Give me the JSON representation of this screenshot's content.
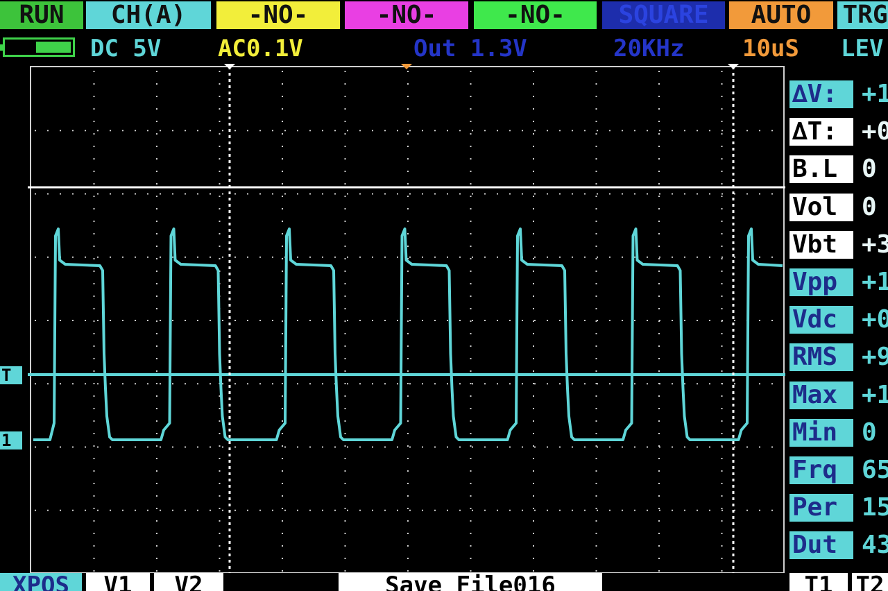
{
  "top_tabs": [
    {
      "label": "RUN",
      "bg": "#3dc33b"
    },
    {
      "label": "CH(A)",
      "bg": "#5fd6d8"
    },
    {
      "label": "-NO-",
      "bg": "#f2ee3a"
    },
    {
      "label": "-NO-",
      "bg": "#e93fe3"
    },
    {
      "label": "-NO-",
      "bg": "#3fe84c"
    },
    {
      "label": "SQUARE",
      "bg": "#1d2dac"
    },
    {
      "label": "AUTO",
      "bg": "#f29a3a"
    },
    {
      "label": "TRG",
      "bg": "#5fd6d8"
    }
  ],
  "status": {
    "coupling": "DC 5V",
    "ac": "AC0.1V",
    "out": "Out 1.3V",
    "freq": "20KHz",
    "timebase": "10uS",
    "trigger": "LEV"
  },
  "markers": {
    "trigger": "T",
    "channel": "1"
  },
  "measurements": [
    {
      "label": "∆V:",
      "value": "+1",
      "style": "cy"
    },
    {
      "label": "∆T:",
      "value": "+0",
      "style": "wh"
    },
    {
      "label": "B.L",
      "value": "0",
      "style": "wh"
    },
    {
      "label": "Vol",
      "value": "0",
      "style": "wh"
    },
    {
      "label": "Vbt",
      "value": "+3",
      "style": "wh"
    },
    {
      "label": "Vpp",
      "value": "+1",
      "style": "cy"
    },
    {
      "label": "Vdc",
      "value": "+0",
      "style": "cy"
    },
    {
      "label": "RMS",
      "value": "+9",
      "style": "cy"
    },
    {
      "label": "Max",
      "value": "+1",
      "style": "cy"
    },
    {
      "label": "Min",
      "value": "0",
      "style": "cy"
    },
    {
      "label": "Frq",
      "value": "65",
      "style": "cy"
    },
    {
      "label": "Per",
      "value": "15",
      "style": "cy"
    },
    {
      "label": "Dut",
      "value": "43",
      "style": "cy"
    }
  ],
  "bottom": {
    "xpos": "XPOS",
    "v1": "V1",
    "v2": "V2",
    "save": "Save File016",
    "t1": "T1",
    "t2": "T2"
  },
  "colors": {
    "trace": "#5fd6d8",
    "grid": "#cfcfcf",
    "background": "#000000"
  }
}
